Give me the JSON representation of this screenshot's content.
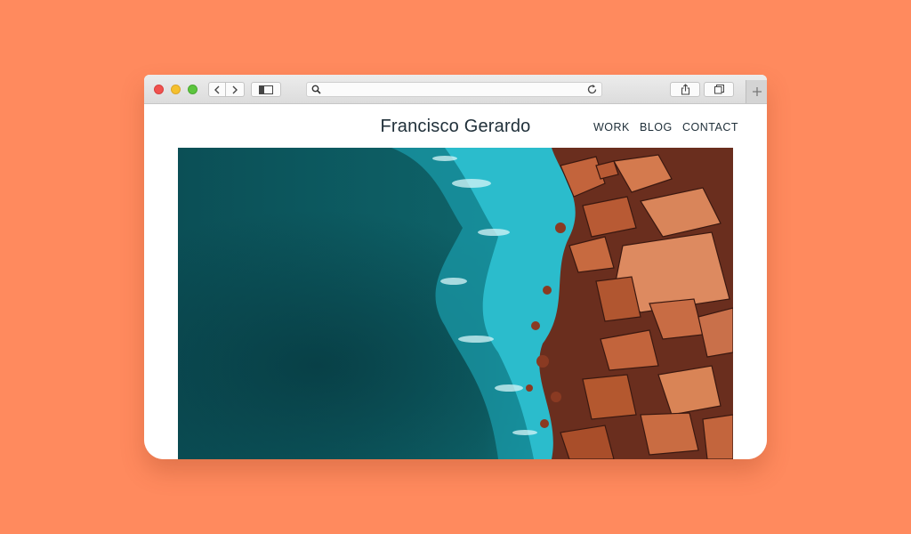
{
  "browser": {
    "toolbar": {
      "back_icon": "chevron-left-icon",
      "forward_icon": "chevron-right-icon",
      "sidebar_icon": "sidebar-icon",
      "search_icon": "magnifier-icon",
      "reload_icon": "reload-icon",
      "share_icon": "share-icon",
      "tabs_icon": "tabs-icon",
      "new_tab_icon": "plus-icon"
    },
    "address_bar": {
      "value": ""
    }
  },
  "site": {
    "title": "Francisco Gerardo",
    "nav": [
      "WORK",
      "BLOG",
      "CONTACT"
    ],
    "hero_image": "aerial-ocean-rocks-photo"
  },
  "colors": {
    "background": "#FF8A5E",
    "ocean": "#0E5B60",
    "surf": "#29B8C8",
    "rocks": "#C4643C",
    "text": "#20303A"
  }
}
